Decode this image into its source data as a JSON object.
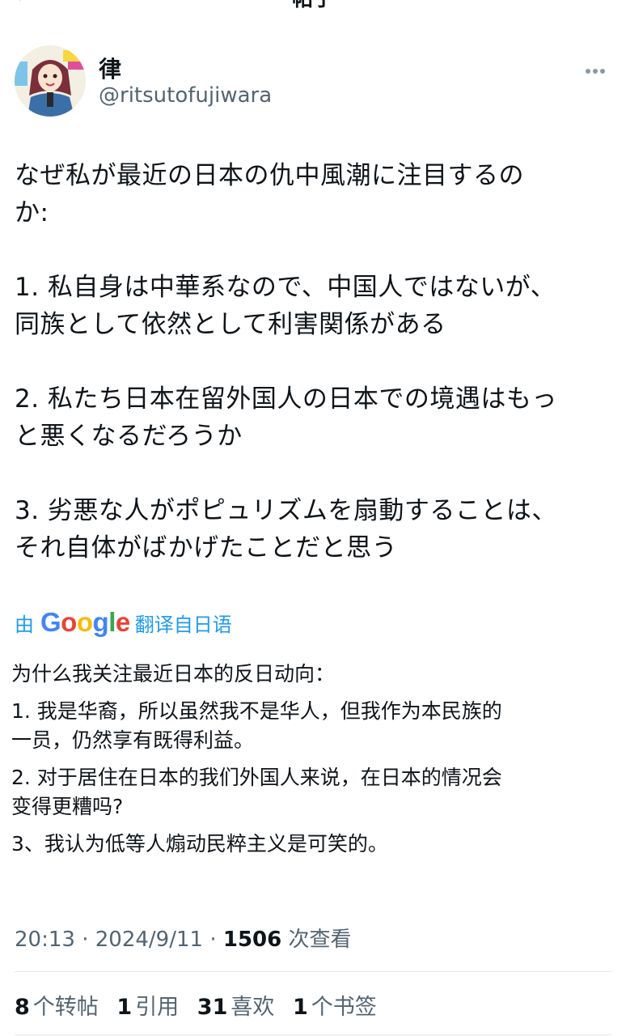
{
  "header": {
    "title": "帖子"
  },
  "author": {
    "name": "律",
    "handle": "@ritsutofujiwara"
  },
  "tweet": {
    "text_lines": [
      "なぜ私が最近の日本の仇中風潮に注目するの\nか:",
      "1. 私自身は中華系なので、中国人ではないが、\n同族として依然として利害関係がある",
      "2. 私たち日本在留外国人の日本での境遇はもっ\nと悪くなるだろうか",
      "3. 劣悪な人がポピュリズムを扇動することは、\nそれ自体がばかげたことだと思う"
    ]
  },
  "translate": {
    "prefix": "由",
    "brand": "Google",
    "suffix": "翻译自日语"
  },
  "translation": {
    "lines": [
      "为什么我关注最近日本的反日动向：",
      "1. 我是华裔，所以虽然我不是华人，但我作为本民族的\n一员，仍然享有既得利益。",
      "2. 对于居住在日本的我们外国人来说，在日本的情况会\n变得更糟吗?",
      "3、我认为低等人煽动民粹主义是可笑的。"
    ]
  },
  "meta": {
    "time": "20:13",
    "date": "2024/9/11",
    "views_count": "1506",
    "views_label": "次查看"
  },
  "stats": {
    "retweets_num": "8",
    "retweets_label": "个转帖",
    "quotes_num": "1",
    "quotes_label": "引用",
    "likes_num": "31",
    "likes_label": "喜欢",
    "bookmarks_num": "1",
    "bookmarks_label": "个书签"
  },
  "colors": {
    "link": "#1d9bf0",
    "secondary_text": "#536471",
    "primary_text": "#0f1419"
  }
}
